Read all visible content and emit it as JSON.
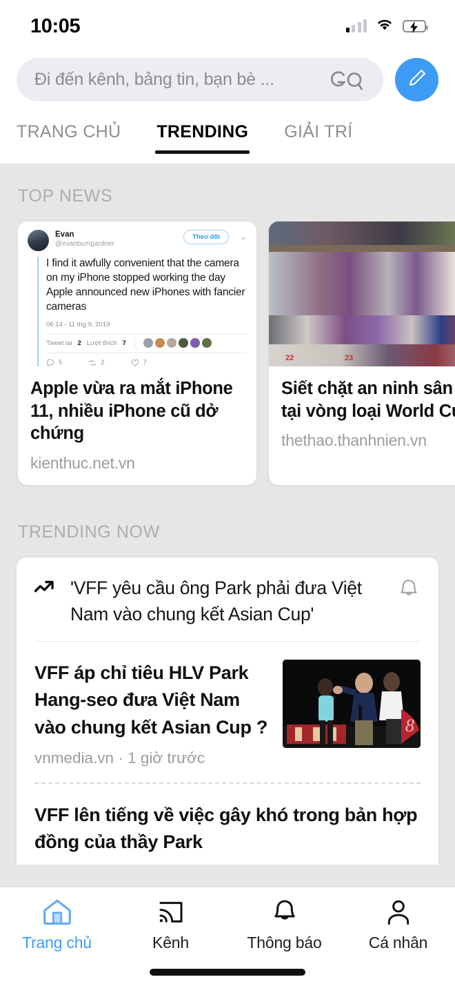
{
  "status_bar": {
    "time": "10:05",
    "signal_icon": "cellular-signal-icon",
    "wifi_icon": "wifi-icon",
    "battery_icon": "battery-charging-icon"
  },
  "search": {
    "placeholder": "Đi đến kênh, bảng tin, bạn bè ...",
    "logo_text": "GO",
    "logo_icon": "go-search-logo-icon",
    "compose_icon": "pencil-compose-icon",
    "accent_color": "#3d9bf6",
    "field_bg": "#ededf1"
  },
  "tabs": [
    {
      "label": "TRANG CHỦ",
      "active": false
    },
    {
      "label": "TRENDING",
      "active": true
    },
    {
      "label": "GIẢI TRÍ",
      "active": false
    }
  ],
  "top_news": {
    "section_title": "TOP NEWS",
    "cards": [
      {
        "headline": "Apple vừa ra mắt iPhone 11, nhiều iPhone cũ dở chứng",
        "source": "kienthuc.net.vn",
        "media_type": "tweet-embed",
        "tweet": {
          "author_name": "Evan",
          "author_handle": "@evanbumgardner",
          "follow_label": "Theo dõi",
          "chevron_icon": "chevron-down-icon",
          "text": "I find it awfully convenient that the camera on my iPhone stopped working the day Apple announced new iPhones with fancier cameras",
          "timestamp": "06:14 - 11 thg 9, 2019",
          "retweet_label": "Tweet lại",
          "retweet_count": "2",
          "likes_label": "Lượt thích",
          "likes_count": "7",
          "reply_action_count": "5",
          "retweet_action_count": "2",
          "like_action_count": "7",
          "liker_avatar_count": 6
        }
      },
      {
        "headline": "Siết chặt an ninh sân Mỹ tại vòng loại World Cup",
        "source": "thethao.thanhnien.vn",
        "media_type": "photo",
        "photo_description": "stadium-crowd-photo",
        "seat_numbers": [
          "22",
          "23"
        ]
      }
    ]
  },
  "trending_now": {
    "section_title": "TRENDING NOW",
    "card": {
      "trend_icon": "trending-up-arrow-icon",
      "trend_title": "'VFF yêu cầu ông Park phải đưa Việt Nam vào chung kết Asian Cup'",
      "bell_icon": "bell-notification-icon",
      "articles": [
        {
          "title": "VFF áp chỉ tiêu HLV Park Hang-seo đưa Việt Nam vào chung kết Asian Cup ?",
          "source": "vnmedia.vn",
          "separator": "·",
          "time": "1 giờ trước",
          "thumbnail": "park-hang-seo-sideline-photo"
        },
        {
          "title": "VFF lên tiếng về việc gây khó trong bản hợp đồng của thầy Park"
        }
      ]
    }
  },
  "bottom_nav": {
    "items": [
      {
        "label": "Trang chủ",
        "icon": "home-icon",
        "active": true
      },
      {
        "label": "Kênh",
        "icon": "cast-channel-icon",
        "active": false
      },
      {
        "label": "Thông báo",
        "icon": "bell-icon",
        "active": false
      },
      {
        "label": "Cá nhân",
        "icon": "person-icon",
        "active": false
      }
    ],
    "active_color": "#3d9bf6"
  }
}
